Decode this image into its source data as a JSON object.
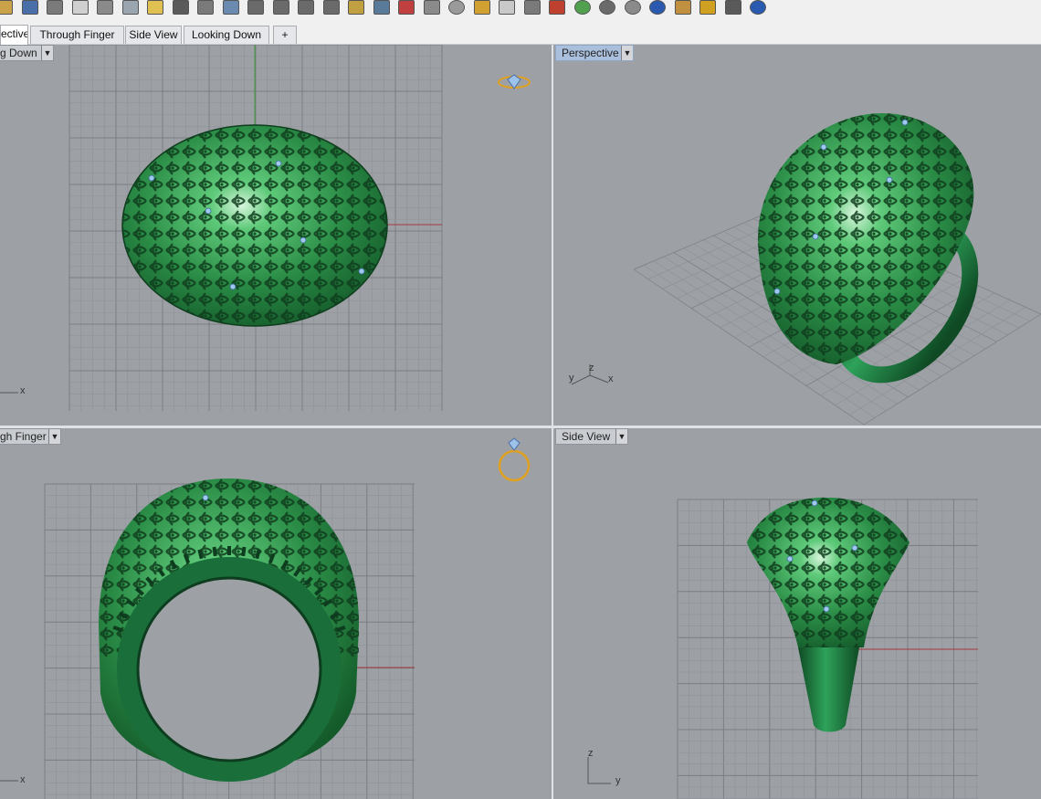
{
  "toolbar": {
    "icons": [
      "open-icon",
      "save-icon",
      "print-icon",
      "new-icon",
      "cut-icon",
      "copy-icon",
      "paste-icon",
      "undo-icon",
      "pan-icon",
      "rotate-icon",
      "zoom-icon",
      "zoom-window-icon",
      "zoom-extents-icon",
      "zoom-selected-icon",
      "zoom-target-icon",
      "viewport-layout-icon",
      "car-icon",
      "ghosted-icon",
      "circle-icon",
      "select-icon",
      "light-icon",
      "lock-icon",
      "material-icon",
      "color-wheel-icon",
      "sphere-icon",
      "render-sphere-icon",
      "blue-sphere-icon",
      "pencil-icon",
      "gear-icon",
      "snap-icon",
      "help-icon"
    ]
  },
  "tabs": [
    {
      "label": "ective"
    },
    {
      "label": "Through Finger"
    },
    {
      "label": "Side View"
    },
    {
      "label": "Looking Down"
    },
    {
      "label": "+"
    }
  ],
  "viewports": {
    "top_left": {
      "label": "g Down",
      "axis_x": "x"
    },
    "top_right": {
      "label": "Perspective",
      "axis_x": "x",
      "axis_y": "y",
      "axis_z": "z"
    },
    "bottom_left": {
      "label": "gh Finger",
      "axis_x": "x"
    },
    "bottom_right": {
      "label": "Side View",
      "axis_y": "y",
      "axis_z": "z"
    }
  },
  "colors": {
    "viewport_bg": "#9da1a6",
    "grid_minor": "#8e9297",
    "grid_major": "#7a7e83",
    "model_green": "#2e9a4f",
    "axis_x_red": "#a23a3a",
    "axis_y_green": "#3a9a3a",
    "active_label": "#a9bfdc"
  }
}
